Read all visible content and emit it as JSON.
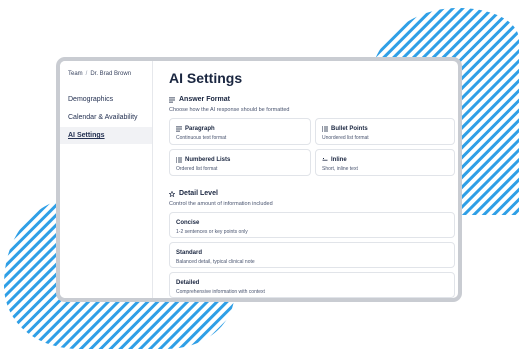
{
  "colors": {
    "accent_stripes": "#2f9fe6",
    "window_border": "#c9ccd2"
  },
  "breadcrumb": {
    "root": "Team",
    "separator": "/",
    "current": "Dr. Brad Brown"
  },
  "sidebar": {
    "items": [
      {
        "label": "Demographics",
        "active": false
      },
      {
        "label": "Calendar & Availability",
        "active": false
      },
      {
        "label": "AI Settings",
        "active": true
      }
    ]
  },
  "page": {
    "title": "AI Settings"
  },
  "answer_format": {
    "heading": "Answer Format",
    "heading_icon": "lines-icon",
    "subtitle": "Choose how the AI response should be formatted",
    "options": [
      {
        "title": "Paragraph",
        "desc": "Continuous text format",
        "icon": "paragraph-icon"
      },
      {
        "title": "Bullet Points",
        "desc": "Unordered list format",
        "icon": "bullet-list-icon"
      },
      {
        "title": "Numbered Lists",
        "desc": "Ordered list format",
        "icon": "numbered-list-icon"
      },
      {
        "title": "Inline",
        "desc": "Short, inline text",
        "icon": "inline-icon"
      }
    ]
  },
  "detail_level": {
    "heading": "Detail Level",
    "heading_icon": "star-icon",
    "subtitle": "Control the amount of information included",
    "options": [
      {
        "title": "Concise",
        "desc": "1-2 sentences or key points only"
      },
      {
        "title": "Standard",
        "desc": "Balanced detail, typical clinical note"
      },
      {
        "title": "Detailed",
        "desc": "Comprehensive information with context"
      }
    ]
  }
}
